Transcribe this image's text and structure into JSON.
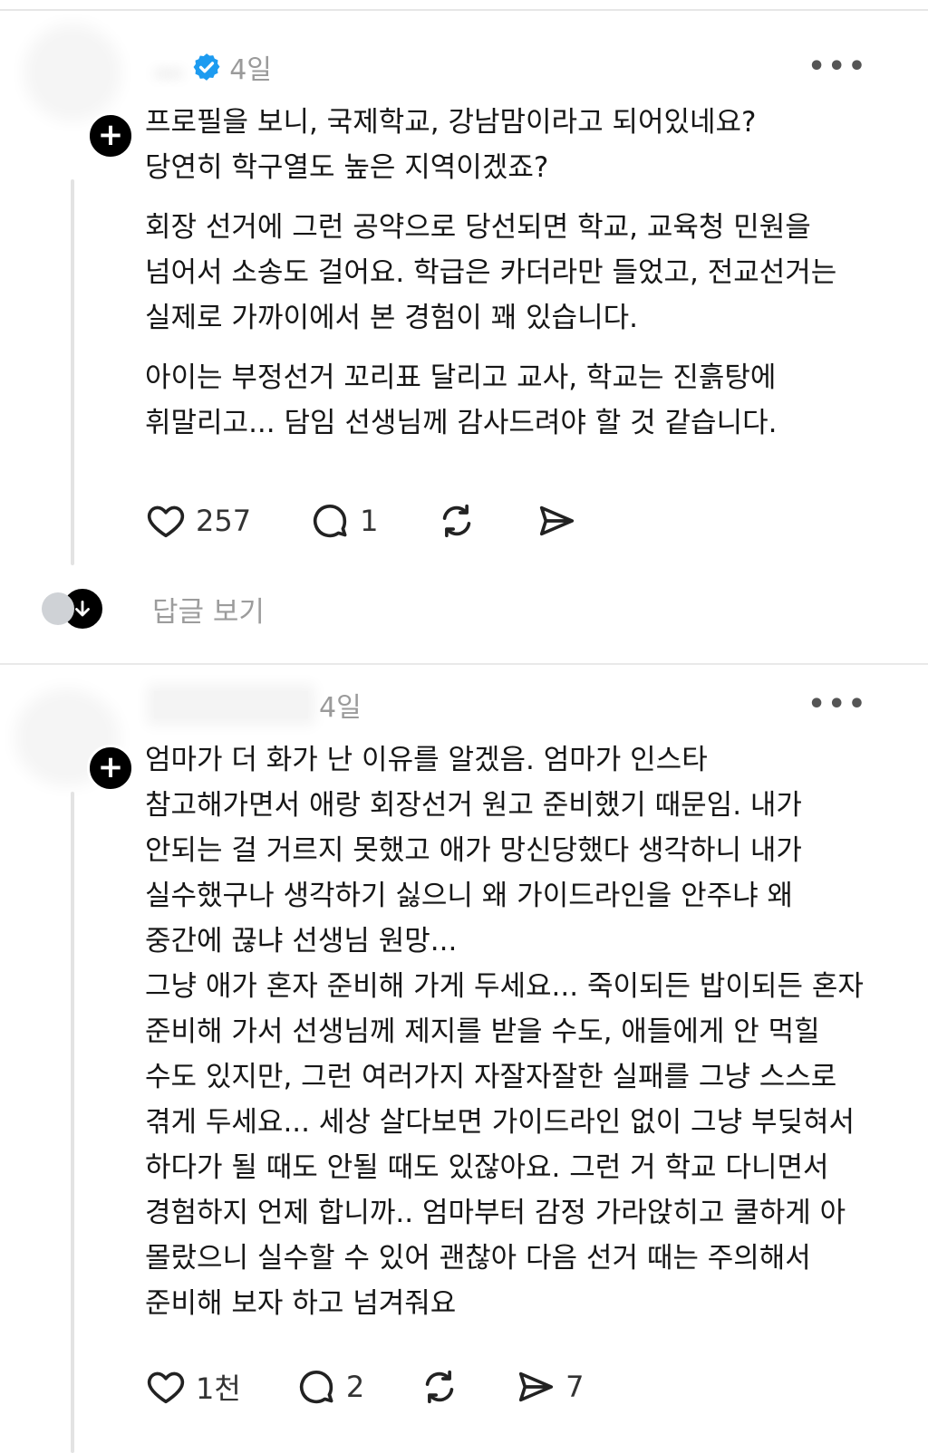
{
  "posts": [
    {
      "username": "...",
      "verified": true,
      "time": "4일",
      "paragraphs": [
        "프로필을 보니, 국제학교, 강남맘이라고 되어있네요?\n당연히 학구열도 높은 지역이겠죠?",
        "회장 선거에 그런 공약으로 당선되면 학교, 교육청 민원을\n넘어서 소송도 걸어요. 학급은 카더라만 들었고, 전교선거는\n실제로 가까이에서 본 경험이 꽤 있습니다.",
        "아이는 부정선거 꼬리표 달리고 교사, 학교는 진흙탕에\n휘말리고... 담임 선생님께 감사드려야 할 것 같습니다."
      ],
      "likes": "257",
      "comments": "1",
      "shares": "",
      "replies_label": "답글 보기"
    },
    {
      "username": "",
      "verified": false,
      "time": "4일",
      "paragraphs": [
        "엄마가 더 화가 난 이유를 알겠음. 엄마가 인스타\n참고해가면서 애랑 회장선거 원고 준비했기 때문임.  내가\n안되는 걸 거르지 못했고 애가 망신당했다 생각하니 내가\n실수했구나 생각하기 싫으니 왜 가이드라인을 안주냐 왜\n중간에 끊냐 선생님 원망...\n그냥 애가 혼자 준비해 가게 두세요... 죽이되든 밥이되든 혼자\n준비해 가서 선생님께 제지를 받을 수도, 애들에게 안 먹힐\n수도 있지만, 그런 여러가지 자잘자잘한 실패를 그냥 스스로\n겪게 두세요... 세상 살다보면 가이드라인 없이 그냥 부딪혀서\n하다가 될 때도 안될 때도 있잖아요.  그런 거 학교 다니면서\n경험하지 언제 합니까.. 엄마부터 감정 가라앉히고 쿨하게 아\n몰랐으니 실수할 수 있어 괜찮아 다음 선거 때는 주의해서\n준비해 보자 하고 넘겨줘요"
      ],
      "likes": "1천",
      "comments": "2",
      "shares": "7"
    }
  ],
  "icons": {
    "like": "heart-icon",
    "comment": "comment-icon",
    "repost": "repost-icon",
    "share": "share-icon",
    "more": "more-icon",
    "verified": "verified-badge-icon"
  },
  "colors": {
    "verified": "#1d9bf0",
    "muted": "#9a9a9a",
    "text": "#161616"
  }
}
